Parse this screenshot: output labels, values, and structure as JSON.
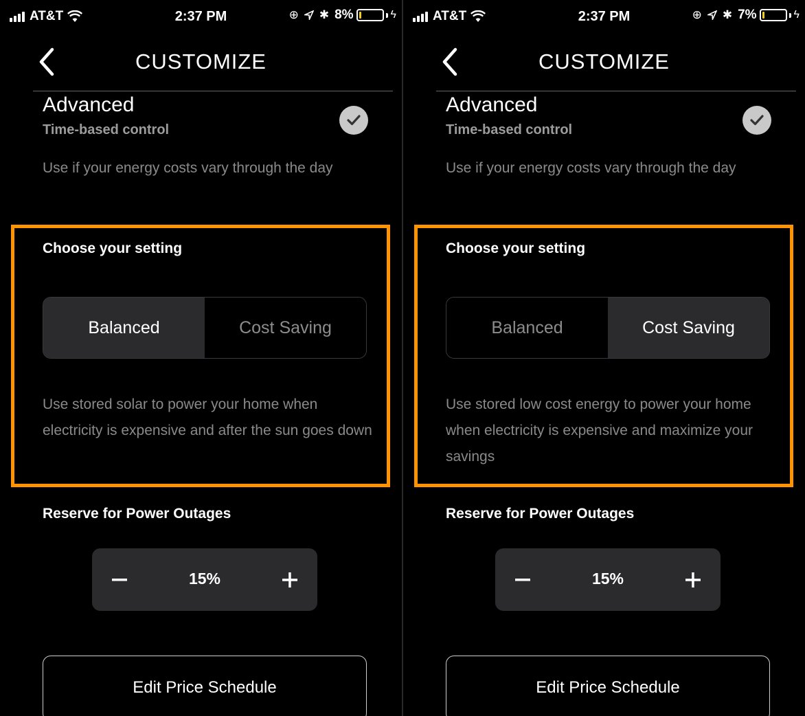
{
  "panels": [
    {
      "status_bar": {
        "carrier": "AT&T",
        "time": "2:37 PM",
        "battery_percent": "8%",
        "battery_level": 0.08,
        "icons": [
          "signal-icon",
          "wifi-icon",
          "rotation-lock-icon",
          "location-icon",
          "bluetooth-icon",
          "battery-icon",
          "charging-icon"
        ]
      },
      "nav": {
        "back_icon": "chevron-left-icon",
        "title": "CUSTOMIZE"
      },
      "advanced": {
        "title": "Advanced",
        "subtitle": "Time-based control",
        "description": "Use if your energy costs vary through the day",
        "checked_icon": "checkmark-icon"
      },
      "setting": {
        "title": "Choose your setting",
        "options": [
          "Balanced",
          "Cost Saving"
        ],
        "selected": "Balanced",
        "description": "Use stored solar to power your home when electricity is expensive and after the sun goes down"
      },
      "reserve": {
        "title": "Reserve for Power Outages",
        "value": "15%",
        "minus": "–",
        "plus": "+"
      },
      "edit_button_label": "Edit Price Schedule"
    },
    {
      "status_bar": {
        "carrier": "AT&T",
        "time": "2:37 PM",
        "battery_percent": "7%",
        "battery_level": 0.07,
        "icons": [
          "signal-icon",
          "wifi-icon",
          "rotation-lock-icon",
          "location-icon",
          "bluetooth-icon",
          "battery-icon",
          "charging-icon"
        ]
      },
      "nav": {
        "back_icon": "chevron-left-icon",
        "title": "CUSTOMIZE"
      },
      "advanced": {
        "title": "Advanced",
        "subtitle": "Time-based control",
        "description": "Use if your energy costs vary through the day",
        "checked_icon": "checkmark-icon"
      },
      "setting": {
        "title": "Choose your setting",
        "options": [
          "Balanced",
          "Cost Saving"
        ],
        "selected": "Cost Saving",
        "description": "Use stored low cost energy to power your home when electricity is expensive and maximize your savings"
      },
      "reserve": {
        "title": "Reserve for Power Outages",
        "value": "15%",
        "minus": "–",
        "plus": "+"
      },
      "edit_button_label": "Edit Price Schedule"
    }
  ],
  "colors": {
    "background": "#000000",
    "highlight": "#ff9400",
    "control_surface": "#2b2b2d",
    "muted_text": "#8a8a8a",
    "battery_fill": "#f5cc1a"
  }
}
